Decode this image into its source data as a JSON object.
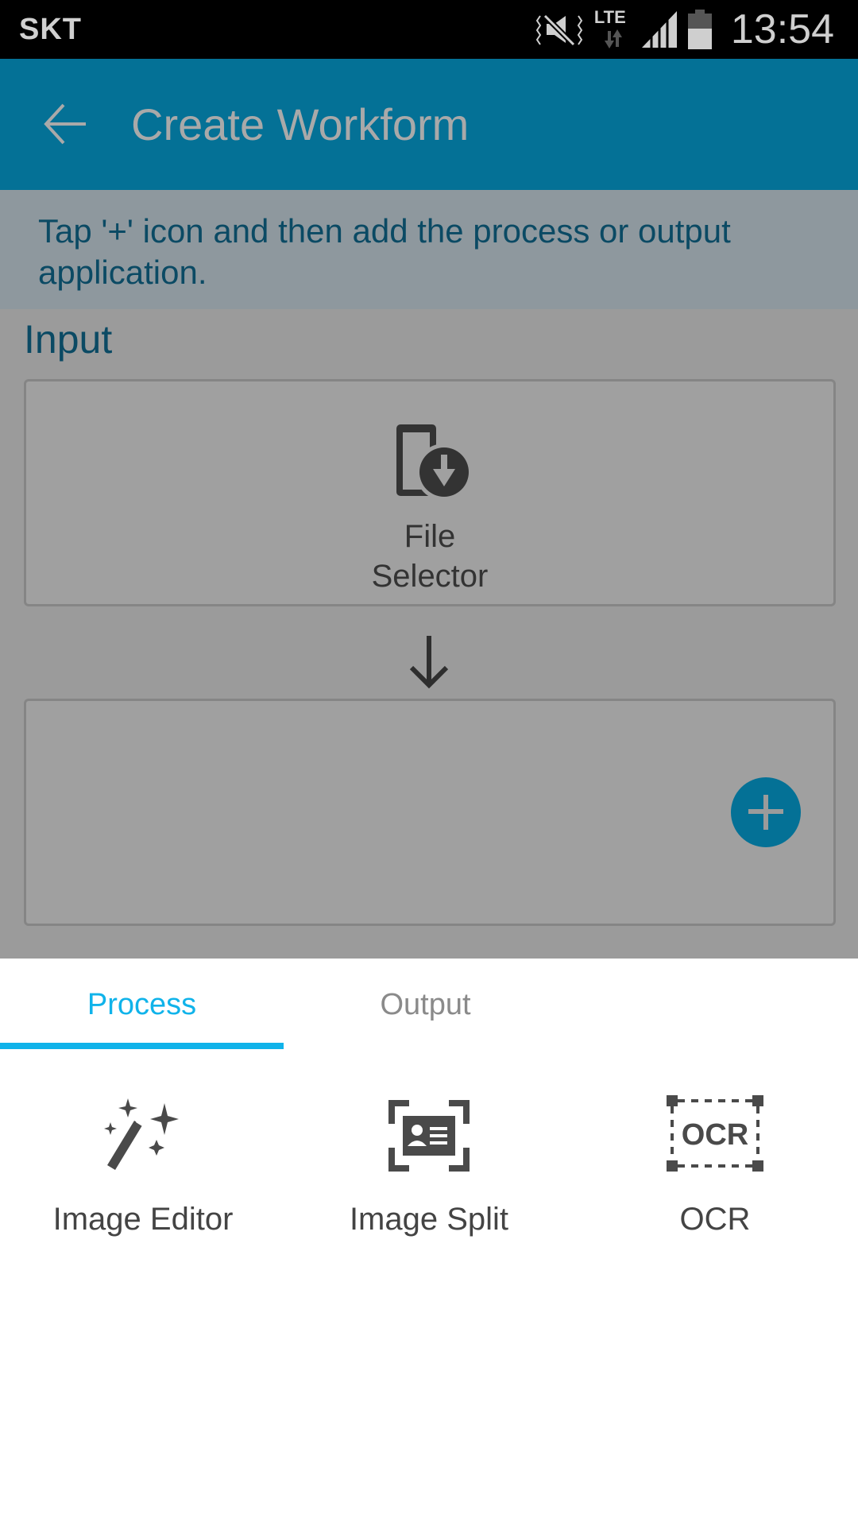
{
  "status_bar": {
    "carrier": "SKT",
    "network": "LTE",
    "time": "13:54",
    "icons": [
      "vibrate-mute-icon",
      "lte-data-icon",
      "signal-icon",
      "battery-icon"
    ]
  },
  "app_bar": {
    "title": "Create Workform",
    "back_icon": "arrow-left-icon"
  },
  "hint": {
    "text": "Tap '+' icon and then add the process or output application."
  },
  "workflow": {
    "input_label": "Input",
    "input_item": {
      "label_line1": "File",
      "label_line2": "Selector",
      "icon": "file-selector-icon"
    },
    "add_button_icon": "plus-icon"
  },
  "bottom_sheet": {
    "tabs": [
      {
        "label": "Process",
        "active": true
      },
      {
        "label": "Output",
        "active": false
      }
    ],
    "items": [
      {
        "label": "Image Editor",
        "icon": "magic-wand-icon"
      },
      {
        "label": "Image Split",
        "icon": "id-card-scan-icon"
      },
      {
        "label": "OCR",
        "icon": "ocr-icon",
        "icon_text": "OCR"
      }
    ]
  },
  "colors": {
    "app_bar": "#047196",
    "accent": "#10b3ea",
    "hint_text": "#0b4a64"
  }
}
